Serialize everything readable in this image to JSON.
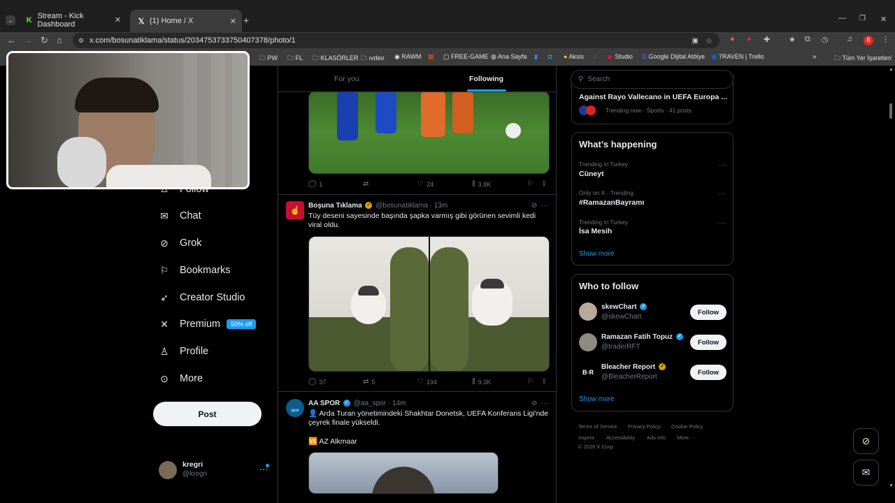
{
  "browser": {
    "tabs": [
      {
        "title": "Stream - Kick Dashboard",
        "icon": "kick-icon",
        "active": false
      },
      {
        "title": "(1) Home / X",
        "icon": "x-logo-icon",
        "active": true
      }
    ],
    "url": "x.com/bosunatiklama/status/2034753733750407378/photo/1",
    "profile_initial": "B",
    "bookmarks": [
      "PW",
      "FL",
      "KLASÖRLER",
      "ıvdeo",
      "RAWM",
      "FREE-GAME",
      "Ana Sayfa",
      "Aksis",
      "Studio",
      "Google Dijital Atölye",
      "7RAVEN | Trello"
    ],
    "all_bookmarks": "Tüm Yer İşaretleri"
  },
  "nav": {
    "follow_partial": "Follow",
    "items": [
      {
        "label": "Chat",
        "icon": "mail-icon"
      },
      {
        "label": "Grok",
        "icon": "grok-icon"
      },
      {
        "label": "Bookmarks",
        "icon": "bookmark-icon"
      },
      {
        "label": "Creator Studio",
        "icon": "rocket-icon"
      },
      {
        "label": "Premium",
        "icon": "x-logo-icon"
      },
      {
        "label": "Profile",
        "icon": "person-icon"
      },
      {
        "label": "More",
        "icon": "more-circle-icon"
      }
    ],
    "premium_badge": "50% off",
    "post_label": "Post",
    "account": {
      "name": "kregri",
      "handle": "@kregri"
    }
  },
  "feed": {
    "tabs": {
      "for_you": "For you",
      "following": "Following"
    },
    "tweet0": {
      "replies": "1",
      "reposts": "",
      "likes": "24",
      "views": "3.8K"
    },
    "tweet1": {
      "name": "Boşuna Tıklama",
      "handle": "@bosunatiklama",
      "time": "· 13m",
      "text": "Tüy deseni sayesinde başında şapka varmış gibi görünen sevimli kedi viral oldu.",
      "replies": "37",
      "reposts": "5",
      "likes": "194",
      "views": "9.3K"
    },
    "tweet2": {
      "name": "AA SPOR",
      "handle": "@aa_spor",
      "time": "· 14m",
      "text": "👤 Arda Turan yönetimindeki Shakhtar Donetsk, UEFA Konferans Ligi'nde çeyrek finale yükseldi.",
      "text2": "🆚 AZ Alkmaar",
      "avatar_text": "spor"
    }
  },
  "sidebar": {
    "search_placeholder": "Search",
    "top_trend": {
      "title": "Against Rayo Vallecano in UEFA Europa ...",
      "meta": "Trending now · Sports · 41 posts"
    },
    "happening": {
      "title": "What’s happening",
      "trends": [
        {
          "meta": "Trending in Turkey",
          "name": "Cüneyt"
        },
        {
          "meta": "Only on X · Trending",
          "name": "#RamazanBayramı"
        },
        {
          "meta": "Trending in Turkey",
          "name": "İsa Mesih"
        }
      ],
      "show_more": "Show more"
    },
    "who_to_follow": {
      "title": "Who to follow",
      "users": [
        {
          "name": "skewChart",
          "handle": "@skewChart",
          "badge": "blue",
          "button": "Follow"
        },
        {
          "name": "Ramazan Fatih Topuz",
          "handle": "@traderRFT",
          "badge": "blue",
          "button": "Follow"
        },
        {
          "name": "Bleacher Report",
          "handle": "@BleacherReport",
          "badge": "gold",
          "button": "Follow"
        }
      ],
      "show_more": "Show more"
    },
    "footer": {
      "links1": [
        "Terms of Service",
        "Privacy Policy",
        "Cookie Policy"
      ],
      "links2": [
        "Imprint",
        "Accessibility",
        "Ads info",
        "More ···"
      ],
      "copyright": "© 2026 X Corp."
    }
  },
  "colors": {
    "accent": "#1d9bf0",
    "background": "#000000",
    "border": "#2f3336",
    "muted": "#71767b"
  }
}
